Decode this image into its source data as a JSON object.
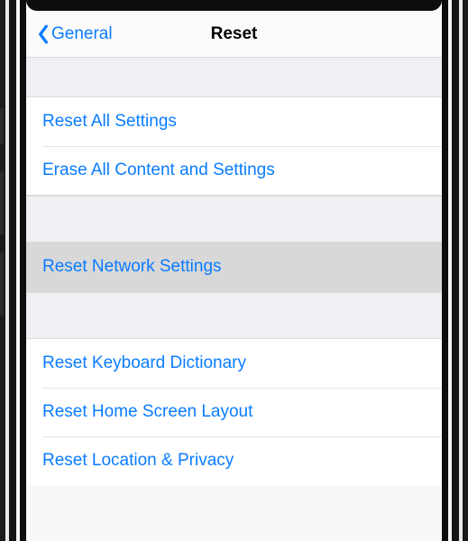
{
  "colors": {
    "link": "#0a7cff",
    "highlight": "#d8d8d8",
    "group_bg": "#efeff4"
  },
  "nav": {
    "back_label": "General",
    "title": "Reset"
  },
  "groups": [
    {
      "rows": [
        {
          "key": "reset-all-settings",
          "label": "Reset All Settings",
          "selected": false
        },
        {
          "key": "erase-all-content-and-settings",
          "label": "Erase All Content and Settings",
          "selected": false
        }
      ]
    },
    {
      "rows": [
        {
          "key": "reset-network-settings",
          "label": "Reset Network Settings",
          "selected": true
        }
      ]
    },
    {
      "rows": [
        {
          "key": "reset-keyboard-dictionary",
          "label": "Reset Keyboard Dictionary",
          "selected": false
        },
        {
          "key": "reset-home-screen-layout",
          "label": "Reset Home Screen Layout",
          "selected": false
        },
        {
          "key": "reset-location-and-privacy",
          "label": "Reset Location & Privacy",
          "selected": false
        }
      ]
    }
  ]
}
